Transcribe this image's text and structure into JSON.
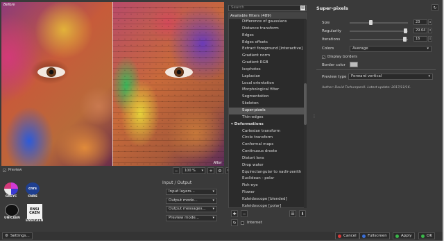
{
  "preview": {
    "before_label": "Before",
    "after_label": "After",
    "zoom": "100 %",
    "preview_checkbox_label": "Preview"
  },
  "logos": {
    "greyc": "GREYC",
    "cnrs": "CNRS",
    "cnrs_mark": "cnrs",
    "unicaen": "UNICAEN",
    "ensicaen": "ENSICAEN",
    "ensicaen_mark_1": "ENSI",
    "ensicaen_mark_2": "CAEN"
  },
  "input_output": {
    "title": "Input / Output",
    "input_layers": "Input layers...",
    "output_mode": "Output mode...",
    "output_messages": "Output messages...",
    "preview_mode": "Preview mode..."
  },
  "filters": {
    "search_placeholder": "Search",
    "header": "Available filters (489)",
    "items": [
      {
        "label": "Difference of gaussians",
        "kind": "item"
      },
      {
        "label": "Distance transform",
        "kind": "item"
      },
      {
        "label": "Edges",
        "kind": "item"
      },
      {
        "label": "Edges offsets",
        "kind": "item"
      },
      {
        "label": "Extract foreground [interactive]",
        "kind": "item"
      },
      {
        "label": "Gradient norm",
        "kind": "item"
      },
      {
        "label": "Gradient RGB",
        "kind": "item"
      },
      {
        "label": "Isophotes",
        "kind": "item"
      },
      {
        "label": "Laplacian",
        "kind": "item"
      },
      {
        "label": "Local orientation",
        "kind": "item"
      },
      {
        "label": "Morphological filter",
        "kind": "item"
      },
      {
        "label": "Segmentation",
        "kind": "item"
      },
      {
        "label": "Skeleton",
        "kind": "item"
      },
      {
        "label": "Super-pixels",
        "kind": "selected"
      },
      {
        "label": "Thin-edges",
        "kind": "item"
      },
      {
        "label": "Deformations",
        "kind": "category"
      },
      {
        "label": "Cartesian transform",
        "kind": "item"
      },
      {
        "label": "Circle transform",
        "kind": "item"
      },
      {
        "label": "Conformal maps",
        "kind": "item"
      },
      {
        "label": "Continuous droste",
        "kind": "item"
      },
      {
        "label": "Distort lens",
        "kind": "item"
      },
      {
        "label": "Drop water",
        "kind": "item"
      },
      {
        "label": "Equirectangular to nadir-zenith",
        "kind": "item"
      },
      {
        "label": "Euclidean - polar",
        "kind": "item"
      },
      {
        "label": "Fish-eye",
        "kind": "item"
      },
      {
        "label": "Flower",
        "kind": "item"
      },
      {
        "label": "Kaleidoscope [blended]",
        "kind": "item"
      },
      {
        "label": "Kaleidoscope [polar]",
        "kind": "item"
      }
    ],
    "internet_label": "Internet"
  },
  "params": {
    "title": "Super-pixels",
    "size_label": "Size",
    "size_value": "23",
    "size_fraction": 0.35,
    "regularity_label": "Regularity",
    "regularity_value": "29.64",
    "regularity_fraction": 0.99,
    "iterations_label": "Iterations",
    "iterations_value": "16",
    "iterations_fraction": 0.98,
    "colors_label": "Colors",
    "colors_value": "Average",
    "display_borders_label": "Display borders",
    "border_color_label": "Border color",
    "preview_type_label": "Preview type",
    "preview_type_value": "Forward vertical",
    "author": "Author: David Tschumperlé. Latest update: 2017/11/16."
  },
  "bottom": {
    "settings": "Settings...",
    "cancel": "Cancel",
    "fullscreen": "Fullscreen",
    "apply": "Apply",
    "ok": "OK"
  },
  "colors": {
    "cancel_dot": "#d93a3a",
    "fullscreen_dot": "#3a6fd9",
    "apply_dot": "#3ab84a",
    "ok_dot": "#3ab84a"
  }
}
